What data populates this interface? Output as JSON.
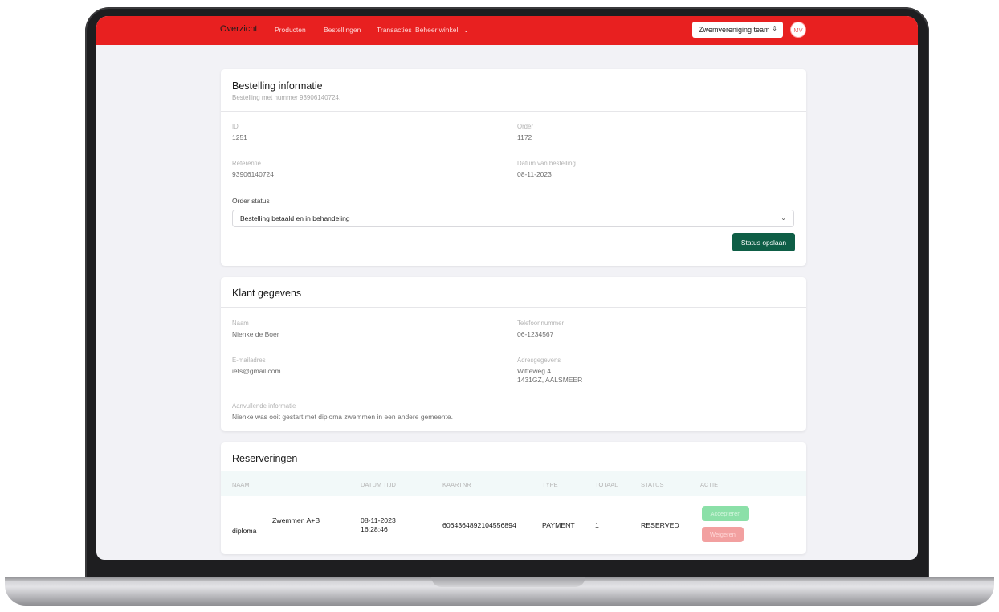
{
  "nav": {
    "items": [
      "Overzicht",
      "Producten",
      "Bestellingen",
      "Transacties",
      "Beheer winkel"
    ],
    "team": "Zwemvereniging team",
    "avatar": "MV"
  },
  "order": {
    "title": "Bestelling informatie",
    "subtitle": "Bestelling met nummer 93906140724.",
    "id_label": "ID",
    "id_value": "1251",
    "order_label": "Order",
    "order_value": "1172",
    "ref_label": "Referentie",
    "ref_value": "93906140724",
    "date_label": "Datum van bestelling",
    "date_value": "08-11-2023",
    "status_label": "Order status",
    "status_value": "Bestelling betaald en in behandeling",
    "save_label": "Status opslaan"
  },
  "customer": {
    "title": "Klant gegevens",
    "name_label": "Naam",
    "name_value": "Nienke de Boer",
    "phone_label": "Telefoonnummer",
    "phone_value": "06-1234567",
    "email_label": "E-mailadres",
    "email_value": "iets@gmail.com",
    "address_label": "Adresgegevens",
    "address_line1": "Witteweg 4",
    "address_line2": "1431GZ, AALSMEER",
    "extra_label": "Aanvullende informatie",
    "extra_value": "Nienke was ooit gestart met diploma zwemmen in een andere gemeente."
  },
  "reservations": {
    "title": "Reserveringen",
    "columns": [
      "NAAM",
      "DATUM TIJD",
      "KAARTNR",
      "TYPE",
      "TOTAAL",
      "STATUS",
      "ACTIE"
    ],
    "rows": [
      {
        "product": "Zwemmen A+B",
        "name": "diploma",
        "date": "08-11-2023",
        "time": "16:28:46",
        "card": "6064364892104556894",
        "type": "PAYMENT",
        "total": "1",
        "status": "RESERVED",
        "accept_label": "Accepteren",
        "reject_label": "Weigeren"
      }
    ]
  },
  "colors": {
    "nav": "#e82020",
    "save_button": "#0e5e46",
    "accept": "#8be0a8",
    "reject": "#f2a0a0",
    "table_header": "#f2f9f9"
  }
}
